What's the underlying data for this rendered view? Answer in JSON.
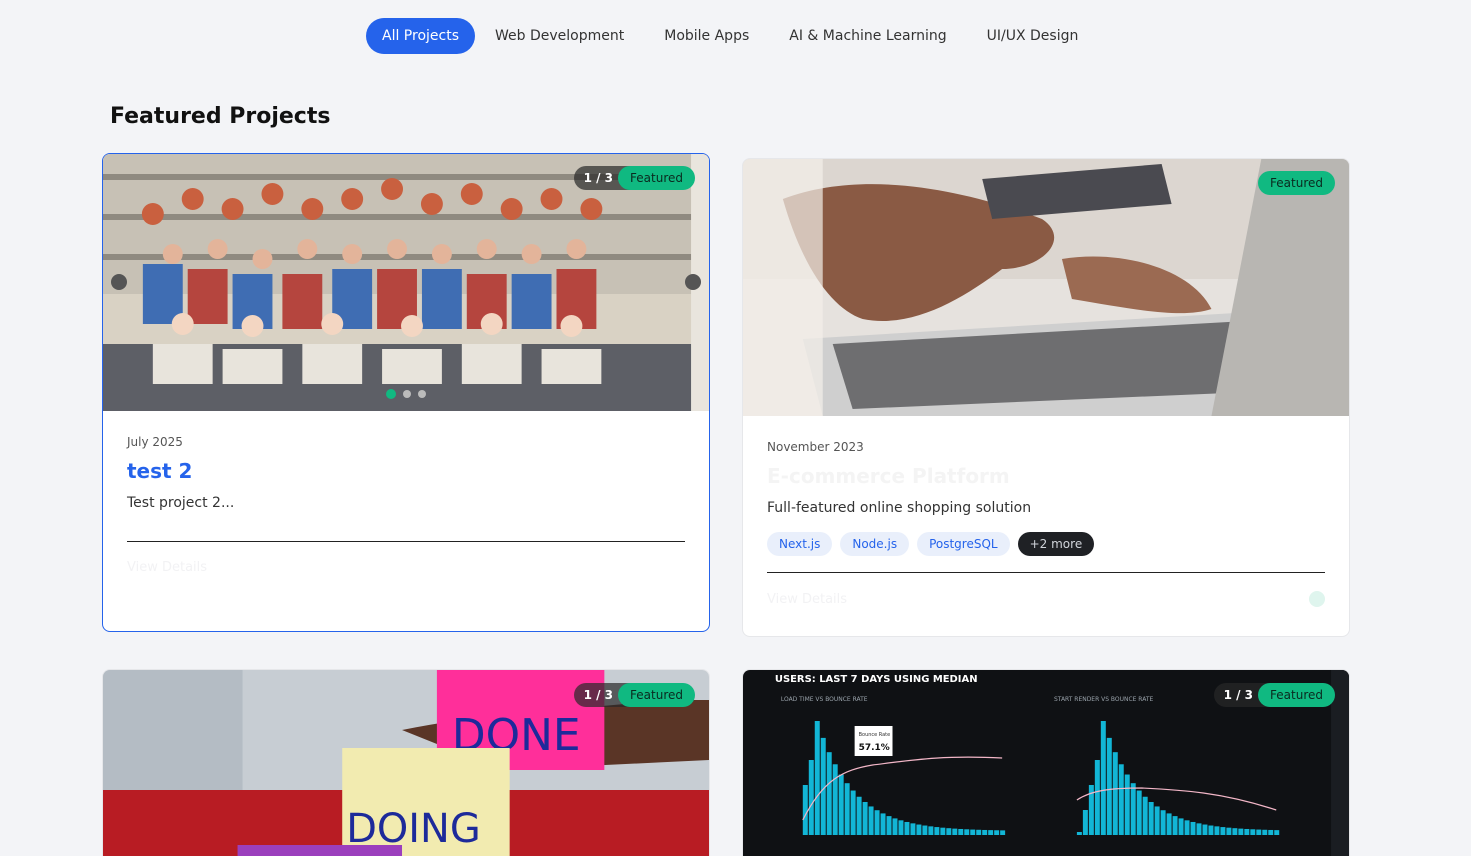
{
  "filters": {
    "tabs": [
      {
        "label": "All Projects"
      },
      {
        "label": "Web Development"
      },
      {
        "label": "Mobile Apps"
      },
      {
        "label": "AI & Machine Learning"
      },
      {
        "label": "UI/UX Design"
      }
    ]
  },
  "section": {
    "title": "Featured Projects"
  },
  "projects": [
    {
      "counter": "1 / 3",
      "badge": "Featured",
      "date": "July 2025",
      "title": "test 2",
      "description": "Test project 2...",
      "view_label": "View Details"
    },
    {
      "badge": "Featured",
      "date": "November 2023",
      "title": "E-commerce Platform",
      "description": "Full-featured online shopping solution",
      "tags": [
        "Next.js",
        "Node.js",
        "PostgreSQL"
      ],
      "more": "+2 more",
      "view_label": "View Details"
    },
    {
      "counter": "1 / 3",
      "badge": "Featured",
      "image_text_top": "DONE",
      "image_text_bottom": "DOING"
    },
    {
      "counter": "1 / 3",
      "badge": "Featured",
      "dash_title": "USERS: LAST 7 DAYS USING MEDIAN",
      "panel_left": "LOAD TIME VS BOUNCE RATE",
      "panel_right": "START RENDER VS BOUNCE RATE",
      "tooltip_label": "Bounce Rate",
      "tooltip_value": "57.1%"
    }
  ],
  "colors": {
    "accent": "#2563eb",
    "featured": "#10b981"
  }
}
